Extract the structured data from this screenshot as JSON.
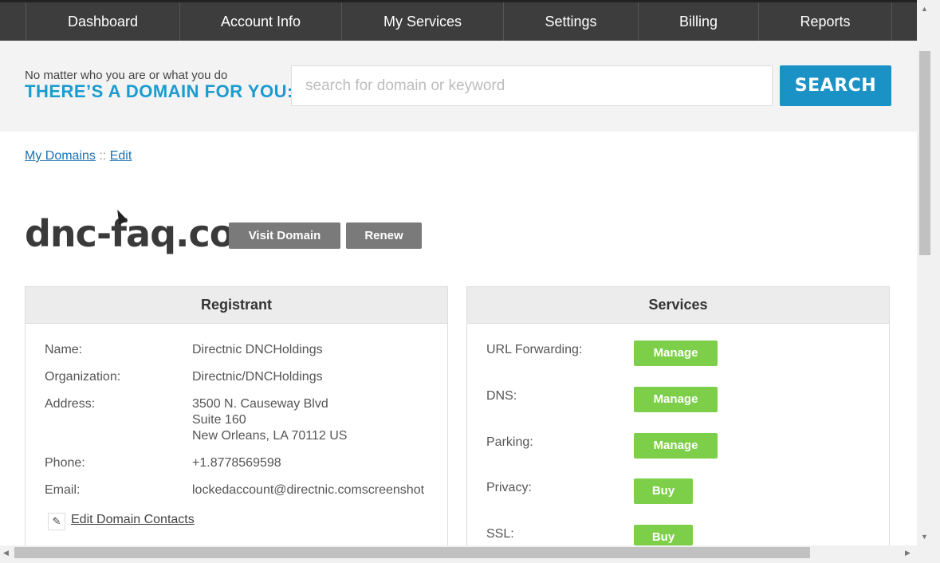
{
  "nav": {
    "items": [
      "Dashboard",
      "Account Info",
      "My Services",
      "Settings",
      "Billing",
      "Reports"
    ]
  },
  "search": {
    "tagline_small": "No matter who you are or what you do",
    "tagline_big": "THERE’S A DOMAIN FOR YOU:",
    "placeholder": "search for domain or keyword",
    "button_label": "SEARCH"
  },
  "breadcrumb": {
    "root": "My Domains",
    "sep": "::",
    "current": "Edit"
  },
  "domain": {
    "name": "dnc-faq.com",
    "visit_label": "Visit Domain",
    "renew_label": "Renew"
  },
  "registrant": {
    "title": "Registrant",
    "name_label": "Name:",
    "name_value": "Directnic DNCHoldings",
    "org_label": "Organization:",
    "org_value": "Directnic/DNCHoldings",
    "address_label": "Address:",
    "address_line1": "3500 N. Causeway Blvd",
    "address_line2": "Suite 160",
    "address_line3": "New Orleans, LA 70112 US",
    "phone_label": "Phone:",
    "phone_value": "+1.8778569598",
    "email_label": "Email:",
    "email_value": "lockedaccount@directnic.comscreenshot",
    "edit_contacts_label": "Edit Domain Contacts"
  },
  "services": {
    "title": "Services",
    "items": [
      {
        "label": "URL Forwarding:",
        "action": "Manage"
      },
      {
        "label": "DNS:",
        "action": "Manage"
      },
      {
        "label": "Parking:",
        "action": "Manage"
      },
      {
        "label": "Privacy:",
        "action": "Buy"
      },
      {
        "label": "SSL:",
        "action": "Buy"
      }
    ]
  },
  "icons": {
    "edit": "pencil-icon",
    "cursor": "mouse-pointer-icon"
  },
  "colors": {
    "nav_bg": "#3d3d3d",
    "accent_blue": "#1b92c6",
    "button_gray": "#7a7a7a",
    "button_green": "#7dcf4a"
  }
}
